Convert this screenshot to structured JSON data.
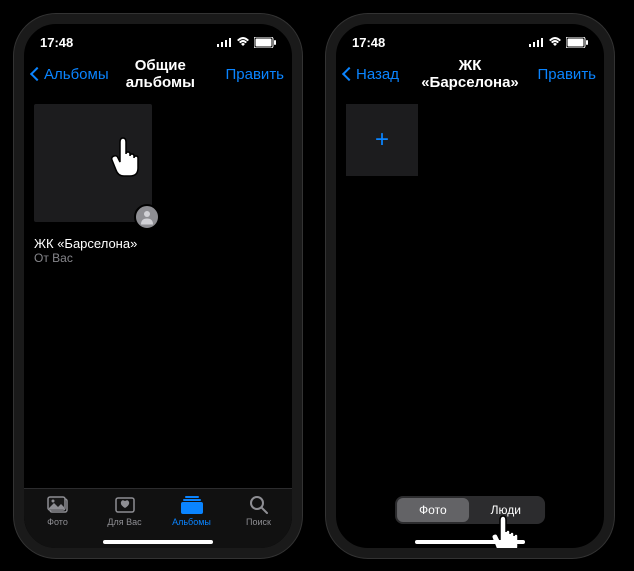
{
  "status": {
    "time": "17:48"
  },
  "colors": {
    "accent": "#0a84ff",
    "secondary": "#8e8e93"
  },
  "left_phone": {
    "nav": {
      "back": "Альбомы",
      "title": "Общие альбомы",
      "right": "Править"
    },
    "album": {
      "title": "ЖК «Барселона»",
      "subtitle": "От Вас"
    },
    "tabs": {
      "photos": "Фото",
      "for_you": "Для Вас",
      "albums": "Альбомы",
      "search": "Поиск"
    }
  },
  "right_phone": {
    "nav": {
      "back": "Назад",
      "title": "ЖК «Барселона»",
      "right": "Править"
    },
    "add_label": "+",
    "segments": {
      "photo": "Фото",
      "people": "Люди"
    }
  }
}
